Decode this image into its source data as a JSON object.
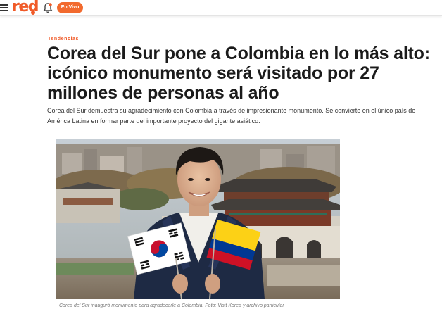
{
  "header": {
    "logo": "red",
    "live_label": "En Vivo",
    "icons": {
      "menu": "menu-icon",
      "notifications": "bell-icon"
    },
    "colors": {
      "brand": "#f05a28",
      "live_button": "#f26a2e"
    }
  },
  "article": {
    "category": "Tendencias",
    "title": "Corea del Sur pone a Colombia en lo más alto: icónico monumento será visitado por 27 millones de personas al año",
    "lead": "Corea del Sur demuestra su agradecimiento con Colombia a través de impresionante monumento. Se convierte en el único país de América Latina en formar parte del importante proyecto del gigante asiático.",
    "image_caption": "Corea del Sur inauguró monumento para agradecerle a Colombia. Foto: Visit Korea y archivo particular"
  }
}
